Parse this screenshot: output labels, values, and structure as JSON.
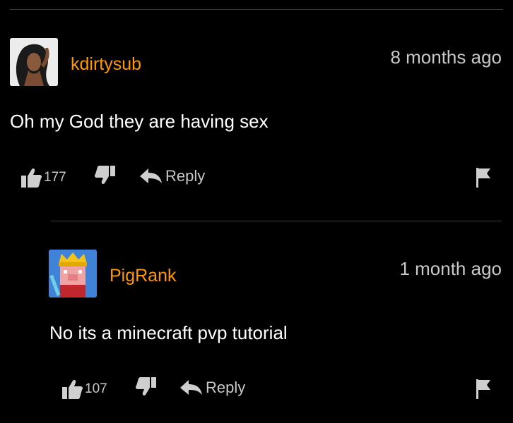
{
  "comments": [
    {
      "username": "kdirtysub",
      "time": "8 months ago",
      "text": "Oh my God they are having sex",
      "likes": "177",
      "reply_label": "Reply",
      "avatar": "user-photo-avatar"
    },
    {
      "username": "PigRank",
      "time": "1 month ago",
      "text": "No its a minecraft pvp tutorial",
      "likes": "107",
      "reply_label": "Reply",
      "avatar": "pig-king-avatar"
    }
  ],
  "icons": {
    "like": "thumbs-up-icon",
    "dislike": "thumbs-down-icon",
    "reply": "reply-arrow-icon",
    "flag": "flag-icon"
  },
  "colors": {
    "background": "#000000",
    "username": "#ff9900",
    "text": "#ffffff",
    "muted": "#c8c8c8",
    "divider": "#3a3a3a"
  }
}
